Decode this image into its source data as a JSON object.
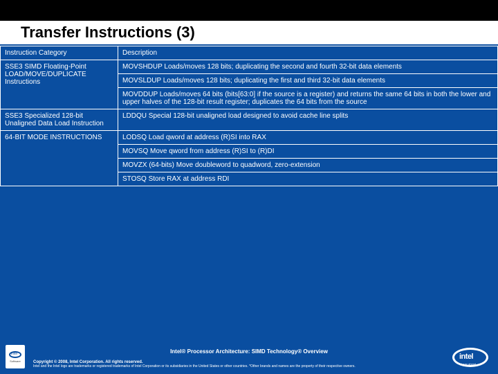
{
  "title": "Transfer Instructions (3)",
  "headers": {
    "col1": "Instruction Category",
    "col2": "Description"
  },
  "rows": [
    {
      "cat": "SSE3 SIMD Floating-Point LOAD/MOVE/DUPLICATE Instructions",
      "desc": "MOVSHDUP Loads/moves 128 bits; duplicating the second and fourth 32-bit data elements",
      "rowspan": 3
    },
    {
      "cat": "",
      "desc": "MOVSLDUP Loads/moves 128 bits; duplicating the first and third 32-bit data elements"
    },
    {
      "cat": "",
      "desc": "MOVDDUP Loads/moves 64 bits (bits[63:0] if the source is a register) and returns the same 64 bits in both the lower and upper halves of the 128-bit result register; duplicates the 64 bits from the source"
    },
    {
      "cat": "SSE3 Specialized 128-bit Unaligned Data Load Instruction",
      "desc": "LDDQU Special 128-bit unaligned load designed to avoid cache line splits",
      "rowspan": 1
    },
    {
      "cat": "64-BIT MODE INSTRUCTIONS",
      "desc": "LODSQ Load qword at address (R)SI into RAX",
      "rowspan": 4
    },
    {
      "cat": "",
      "desc": "MOVSQ Move qword from address (R)SI to (R)DI"
    },
    {
      "cat": "",
      "desc": "MOVZX (64-bits) Move doubleword to quadword, zero-extension"
    },
    {
      "cat": "",
      "desc": "STOSQ Store RAX at address RDI"
    }
  ],
  "footer": {
    "heading": "Intel® Processor Architecture: SIMD Technology® Overview",
    "copyright": "Copyright © 2008, Intel Corporation. All rights reserved.",
    "legal": "Intel and the Intel logo are trademarks or registered trademarks of Intel Corporation or its subsidiaries in the United States or other countries. *Other brands and names are the property of their respective owners.",
    "badge_text": "Software",
    "logo_text": "intel",
    "logo_tag": "Leap ahead"
  }
}
